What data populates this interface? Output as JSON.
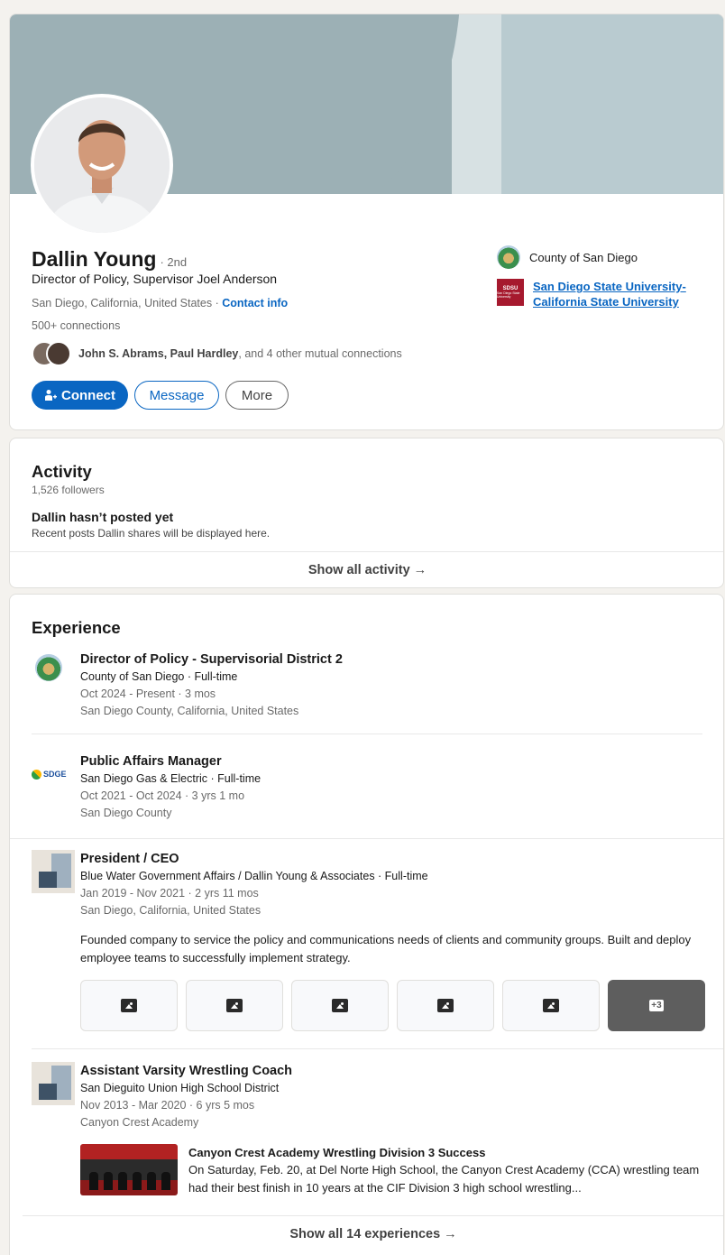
{
  "profile": {
    "name": "Dallin Young",
    "degree": "· 2nd",
    "headline": "Director of Policy, Supervisor Joel Anderson",
    "location": "San Diego, California, United States ·",
    "contact_info": "Contact info",
    "connections": "500+ connections",
    "mutual_names": "John S. Abrams, Paul Hardley",
    "mutual_rest": ", and 4 other mutual connections",
    "connect_label": "Connect",
    "message_label": "Message",
    "more_label": "More",
    "current_org": "County of San Diego",
    "education": "San Diego State University-California State University",
    "sdsu_logo_text": "SDSU",
    "sdsu_logo_sub": "San Diego State University"
  },
  "activity": {
    "title": "Activity",
    "followers": "1,526 followers",
    "empty_title": "Dallin hasn’t posted yet",
    "empty_sub": "Recent posts Dallin shares will be displayed here.",
    "show_all": "Show all activity →"
  },
  "experience": {
    "title": "Experience",
    "show_all": "Show all 14 experiences →",
    "items": [
      {
        "title": "Director of Policy - Supervisorial District 2",
        "company": "County of San Diego · Full-time",
        "dates": "Oct 2024 - Present · 3 mos",
        "location": "San Diego County, California, United States"
      },
      {
        "title": "Public Affairs Manager",
        "company": "San Diego Gas & Electric · Full-time",
        "dates": "Oct 2021 - Oct 2024 · 3 yrs 1 mo",
        "location": "San Diego County",
        "logo_text": "SDGE"
      },
      {
        "title": "President / CEO",
        "company": "Blue Water Government Affairs / Dallin Young & Associates · Full-time",
        "dates": "Jan 2019 - Nov 2021 · 2 yrs 11 mos",
        "location": "San Diego, California, United States",
        "description": "Founded company to service the policy and communications needs of clients and community groups. Built and deploy employee teams to successfully implement strategy.",
        "more_media": "+3"
      },
      {
        "title": "Assistant Varsity Wrestling Coach",
        "company": "San Dieguito Union High School District",
        "dates": "Nov 2013 - Mar 2020 · 6 yrs 5 mos",
        "location": "Canyon Crest Academy",
        "media_title": "Canyon Crest Academy Wrestling Division 3 Success",
        "media_desc": "On Saturday, Feb. 20, at Del Norte High School, the Canyon Crest Academy (CCA) wrestling team had their best finish in 10 years at the CIF Division 3 high school wrestling..."
      }
    ]
  },
  "colors": {
    "primary": "#0a66c2",
    "banner": "#9cb0b5",
    "sdsu": "#a6192e"
  }
}
